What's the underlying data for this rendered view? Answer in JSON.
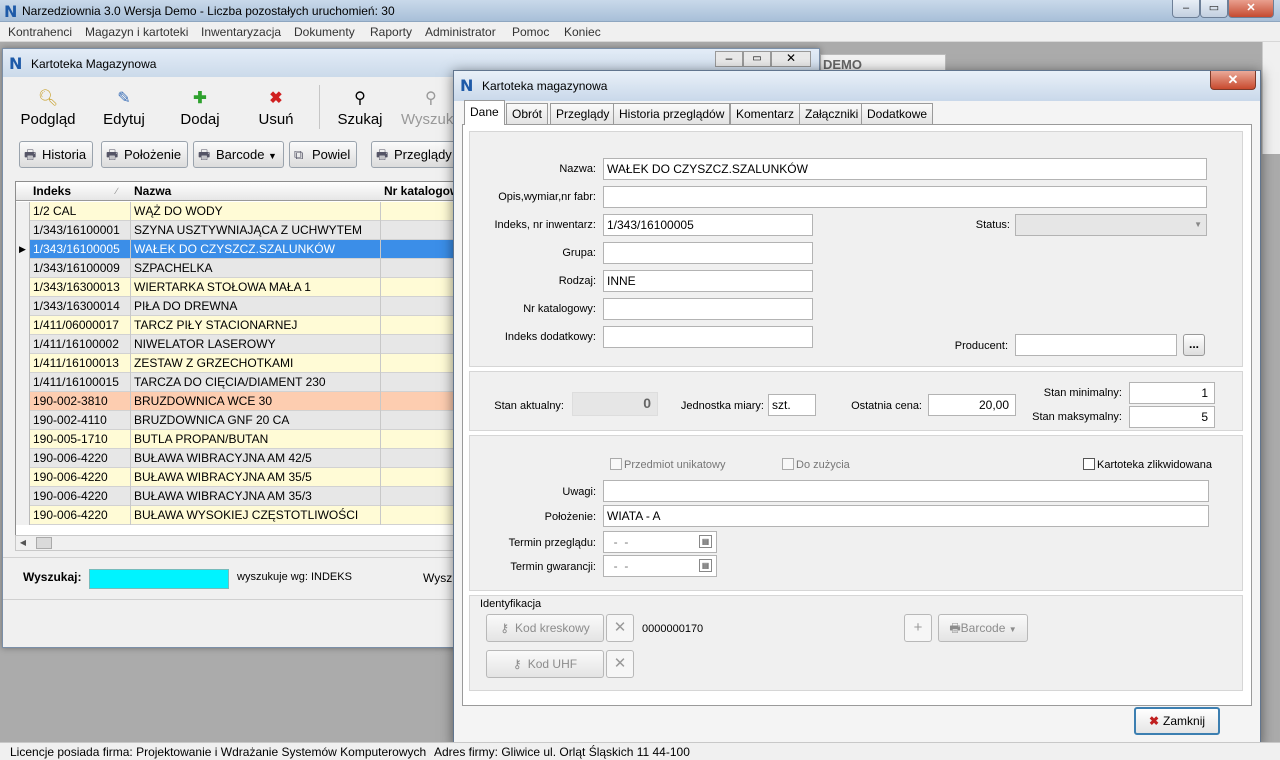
{
  "app": {
    "title": "Narzedziownia  3.0 Wersja Demo - Liczba pozostałych uruchomień:  30",
    "logo": "N",
    "menu": [
      "Kontrahenci",
      "Magazyn i kartoteki",
      "Inwentaryzacja",
      "Dokumenty",
      "Raporty",
      "Administrator",
      "Pomoc",
      "Koniec"
    ]
  },
  "status": {
    "license": "Licencje posiada firma:  Projektowanie i Wdrażanie Systemów Komputerowych",
    "address": "Adres firmy:  Gliwice  ul. Orląt Śląskich 11  44-100"
  },
  "win1": {
    "title": "Kartoteka Magazynowa",
    "toolbar": [
      "Podgląd",
      "Edytuj",
      "Dodaj",
      "Usuń",
      "Szukaj",
      "Wyszuk"
    ],
    "subtoolbar": [
      "Historia",
      "Położenie",
      "Barcode",
      "Powiel",
      "Przeglądy"
    ],
    "columns": [
      "Indeks",
      "Nazwa",
      "Nr katalogow"
    ],
    "rows": [
      {
        "indeks": "1/2 CAL",
        "nazwa": "WĄŻ DO WODY"
      },
      {
        "indeks": "1/343/16100001",
        "nazwa": "SZYNA USZTYWNIAJĄCA Z UCHWYTEM"
      },
      {
        "indeks": "1/343/16100005",
        "nazwa": "WAŁEK DO CZYSZCZ.SZALUNKÓW"
      },
      {
        "indeks": "1/343/16100009",
        "nazwa": "SZPACHELKA"
      },
      {
        "indeks": "1/343/16300013",
        "nazwa": "WIERTARKA STOŁOWA MAŁA 1"
      },
      {
        "indeks": "1/343/16300014",
        "nazwa": "PIŁA DO DREWNA"
      },
      {
        "indeks": "1/411/06000017",
        "nazwa": "TARCZ PIŁY STACIONARNEJ"
      },
      {
        "indeks": "1/411/16100002",
        "nazwa": "NIWELATOR LASEROWY"
      },
      {
        "indeks": "1/411/16100013",
        "nazwa": "ZESTAW Z GRZECHOTKAMI"
      },
      {
        "indeks": "1/411/16100015",
        "nazwa": "TARCZA DO CIĘCIA/DIAMENT 230"
      },
      {
        "indeks": "190-002-3810",
        "nazwa": "BRUZDOWNICA WCE 30"
      },
      {
        "indeks": "190-002-4110",
        "nazwa": "BRUZDOWNICA GNF 20 CA"
      },
      {
        "indeks": "190-005-1710",
        "nazwa": "BUTLA PROPAN/BUTAN"
      },
      {
        "indeks": "190-006-4220",
        "nazwa": "BUŁAWA WIBRACYJNA  AM 42/5"
      },
      {
        "indeks": "190-006-4220",
        "nazwa": "BUŁAWA WIBRACYJNA  AM 35/5"
      },
      {
        "indeks": "190-006-4220",
        "nazwa": "BUŁAWA WIBRACYJNA  AM 35/3"
      },
      {
        "indeks": "190-006-4220",
        "nazwa": "BUŁAWA WYSOKIEJ CZĘSTOTLIWOŚCI"
      }
    ],
    "search_label": "Wyszukaj:",
    "search_by": "wyszukuje wg:  INDEKS",
    "search_cut": "Wyszu",
    "demo_text": "DEMO"
  },
  "dlg": {
    "title": "Kartoteka magazynowa",
    "tabs": [
      "Dane",
      "Obrót",
      "Przeglądy",
      "Historia przeglądów",
      "Komentarz",
      "Załączniki",
      "Dodatkowe"
    ],
    "labels": {
      "nazwa": "Nazwa:",
      "opis": "Opis,wymiar,nr fabr:",
      "indeks": "Indeks, nr inwentarz:",
      "grupa": "Grupa:",
      "rodzaj": "Rodzaj:",
      "nrkat": "Nr katalogowy:",
      "indeksdod": "Indeks dodatkowy:",
      "status": "Status:",
      "producent": "Producent:",
      "stan_akt": "Stan aktualny:",
      "jm": "Jednostka miary:",
      "cena": "Ostatnia cena:",
      "stan_min": "Stan minimalny:",
      "stan_max": "Stan maksymalny:",
      "uwagi": "Uwagi:",
      "polozenie": "Położenie:",
      "termin_p": "Termin przeglądu:",
      "termin_g": "Termin gwarancji:"
    },
    "values": {
      "nazwa": "WAŁEK DO CZYSZCZ.SZALUNKÓW",
      "opis": "",
      "indeks": "1/343/16100005",
      "grupa": "",
      "rodzaj": "INNE",
      "nrkat": "",
      "indeksdod": "",
      "status": "",
      "producent": "",
      "stan_akt": "0",
      "jm": "szt.",
      "cena": "20,00",
      "stan_min": "1",
      "stan_max": "5",
      "uwagi": "",
      "polozenie": "WIATA - A",
      "termin_p": "  -  -",
      "termin_g": "  -  -"
    },
    "checks": {
      "unikat": "Przedmiot unikatowy",
      "zuzycie": "Do zużycia",
      "zlikw": "Kartoteka zlikwidowana"
    },
    "ident": {
      "title": "Identyfikacja",
      "kod": "Kod kreskowy",
      "kod_value": "0000000170",
      "uhf": "Kod UHF",
      "barcode": "Barcode"
    },
    "close_label": "Zamknij",
    "browse_label": "..."
  }
}
